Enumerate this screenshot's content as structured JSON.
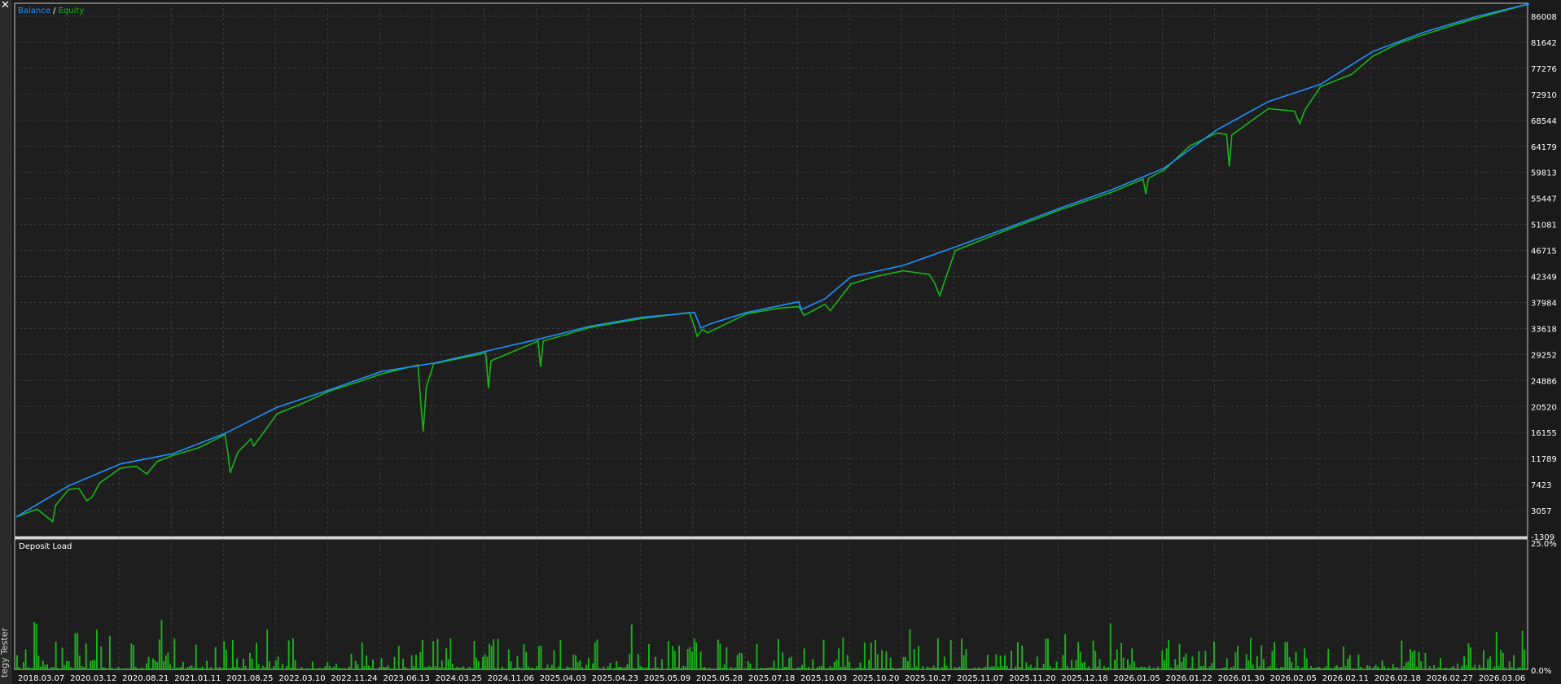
{
  "window": {
    "close_icon": "close-icon",
    "vertical_tab_label": "tegy Tester"
  },
  "colors": {
    "background": "#1e1e1e",
    "grid": "#3c3c3c",
    "balance": "#1e90ff",
    "equity": "#18b418",
    "deposit": "#19b419",
    "text": "#ffffff"
  },
  "chart_data": [
    {
      "type": "line",
      "legend": {
        "balance_label": "Balance",
        "separator": " / ",
        "equity_label": "Equity",
        "placement": "top-left"
      },
      "y_ticks": [
        86008,
        81642,
        77276,
        72910,
        68544,
        64179,
        59813,
        55447,
        51081,
        46715,
        42349,
        37984,
        33618,
        29252,
        24886,
        20520,
        16155,
        11789,
        7423,
        3057,
        -1309
      ],
      "ylim": [
        -1309,
        88200
      ],
      "grid": true,
      "x_ticks": [
        "2018.03.07",
        "2020.03.12",
        "2020.08.21",
        "2021.01.11",
        "2021.08.25",
        "2022.03.10",
        "2022.11.24",
        "2023.06.13",
        "2024.03.25",
        "2024.11.06",
        "2025.04.03",
        "2025.04.23",
        "2025.05.09",
        "2025.05.28",
        "2025.07.18",
        "2025.10.03",
        "2025.10.20",
        "2025.10.27",
        "2025.11.07",
        "2025.11.20",
        "2025.12.18",
        "2026.01.05",
        "2026.01.22",
        "2026.01.30",
        "2026.02.05",
        "2026.02.11",
        "2026.02.18",
        "2026.02.27",
        "2026.03.06"
      ],
      "series": [
        {
          "name": "Balance",
          "points": [
            [
              0,
              2000
            ],
            [
              1,
              7200
            ],
            [
              2,
              10900
            ],
            [
              3,
              12600
            ],
            [
              4,
              16000
            ],
            [
              5,
              20400
            ],
            [
              6,
              23300
            ],
            [
              7,
              26400
            ],
            [
              8,
              27800
            ],
            [
              9,
              29800
            ],
            [
              10,
              31800
            ],
            [
              11,
              34000
            ],
            [
              12,
              35500
            ],
            [
              13,
              36300
            ],
            [
              13.12,
              33700
            ],
            [
              13.3,
              34400
            ],
            [
              14,
              36300
            ],
            [
              15,
              38100
            ],
            [
              15.05,
              36800
            ],
            [
              15.5,
              38600
            ],
            [
              16,
              42300
            ],
            [
              17,
              44200
            ],
            [
              18,
              47300
            ],
            [
              19,
              50500
            ],
            [
              20,
              53800
            ],
            [
              21,
              56900
            ],
            [
              22,
              60500
            ],
            [
              23,
              66900
            ],
            [
              24,
              71700
            ],
            [
              25,
              74600
            ],
            [
              26,
              80100
            ],
            [
              27,
              83400
            ],
            [
              28,
              86000
            ],
            [
              29,
              88100
            ]
          ]
        },
        {
          "name": "Equity",
          "points": [
            [
              0,
              2000
            ],
            [
              0.4,
              3300
            ],
            [
              0.7,
              1200
            ],
            [
              0.75,
              3900
            ],
            [
              1,
              6600
            ],
            [
              1.2,
              6800
            ],
            [
              1.35,
              4700
            ],
            [
              1.45,
              5300
            ],
            [
              1.6,
              7700
            ],
            [
              2,
              10200
            ],
            [
              2.3,
              10500
            ],
            [
              2.5,
              9200
            ],
            [
              2.7,
              11300
            ],
            [
              3,
              12300
            ],
            [
              3.5,
              13600
            ],
            [
              4,
              15800
            ],
            [
              4.05,
              13100
            ],
            [
              4.1,
              9400
            ],
            [
              4.25,
              12900
            ],
            [
              4.5,
              15100
            ],
            [
              4.55,
              13900
            ],
            [
              5,
              19300
            ],
            [
              5.5,
              21100
            ],
            [
              6,
              23100
            ],
            [
              6.5,
              24500
            ],
            [
              7,
              26000
            ],
            [
              7.7,
              27500
            ],
            [
              7.75,
              21600
            ],
            [
              7.8,
              16300
            ],
            [
              7.86,
              23800
            ],
            [
              8,
              27700
            ],
            [
              9,
              29500
            ],
            [
              9.05,
              23600
            ],
            [
              9.1,
              28200
            ],
            [
              10,
              31500
            ],
            [
              10.05,
              27200
            ],
            [
              10.1,
              31500
            ],
            [
              11,
              33800
            ],
            [
              12,
              35300
            ],
            [
              12.9,
              36300
            ],
            [
              13,
              33900
            ],
            [
              13.05,
              32300
            ],
            [
              13.15,
              33500
            ],
            [
              13.25,
              32900
            ],
            [
              13.35,
              33300
            ],
            [
              14,
              36100
            ],
            [
              14.6,
              37000
            ],
            [
              15,
              37300
            ],
            [
              15.1,
              35800
            ],
            [
              15.5,
              37700
            ],
            [
              15.6,
              36600
            ],
            [
              16,
              41100
            ],
            [
              16.5,
              42400
            ],
            [
              17,
              43300
            ],
            [
              17.5,
              42700
            ],
            [
              17.6,
              41300
            ],
            [
              17.7,
              39100
            ],
            [
              17.8,
              41700
            ],
            [
              18,
              46700
            ],
            [
              19,
              50200
            ],
            [
              20,
              53500
            ],
            [
              21,
              56500
            ],
            [
              21.6,
              58700
            ],
            [
              21.65,
              56200
            ],
            [
              21.7,
              58800
            ],
            [
              22,
              60200
            ],
            [
              22.5,
              64300
            ],
            [
              23,
              66400
            ],
            [
              23.2,
              66200
            ],
            [
              23.25,
              60800
            ],
            [
              23.3,
              66100
            ],
            [
              24,
              70500
            ],
            [
              24.5,
              70100
            ],
            [
              24.6,
              68000
            ],
            [
              24.7,
              70300
            ],
            [
              25,
              74200
            ],
            [
              25.6,
              76300
            ],
            [
              26,
              79300
            ],
            [
              26.5,
              81500
            ],
            [
              27,
              83000
            ],
            [
              27.5,
              84400
            ],
            [
              28,
              85700
            ],
            [
              28.5,
              86900
            ],
            [
              29,
              88100
            ]
          ]
        }
      ]
    },
    {
      "type": "bar",
      "title": "Deposit Load",
      "y_ticks": [
        "25.0%",
        "0.0%"
      ],
      "ylim": [
        0,
        25.0
      ],
      "units": "%",
      "series": [
        {
          "name": "Deposit Load",
          "count": 700
        }
      ]
    }
  ]
}
